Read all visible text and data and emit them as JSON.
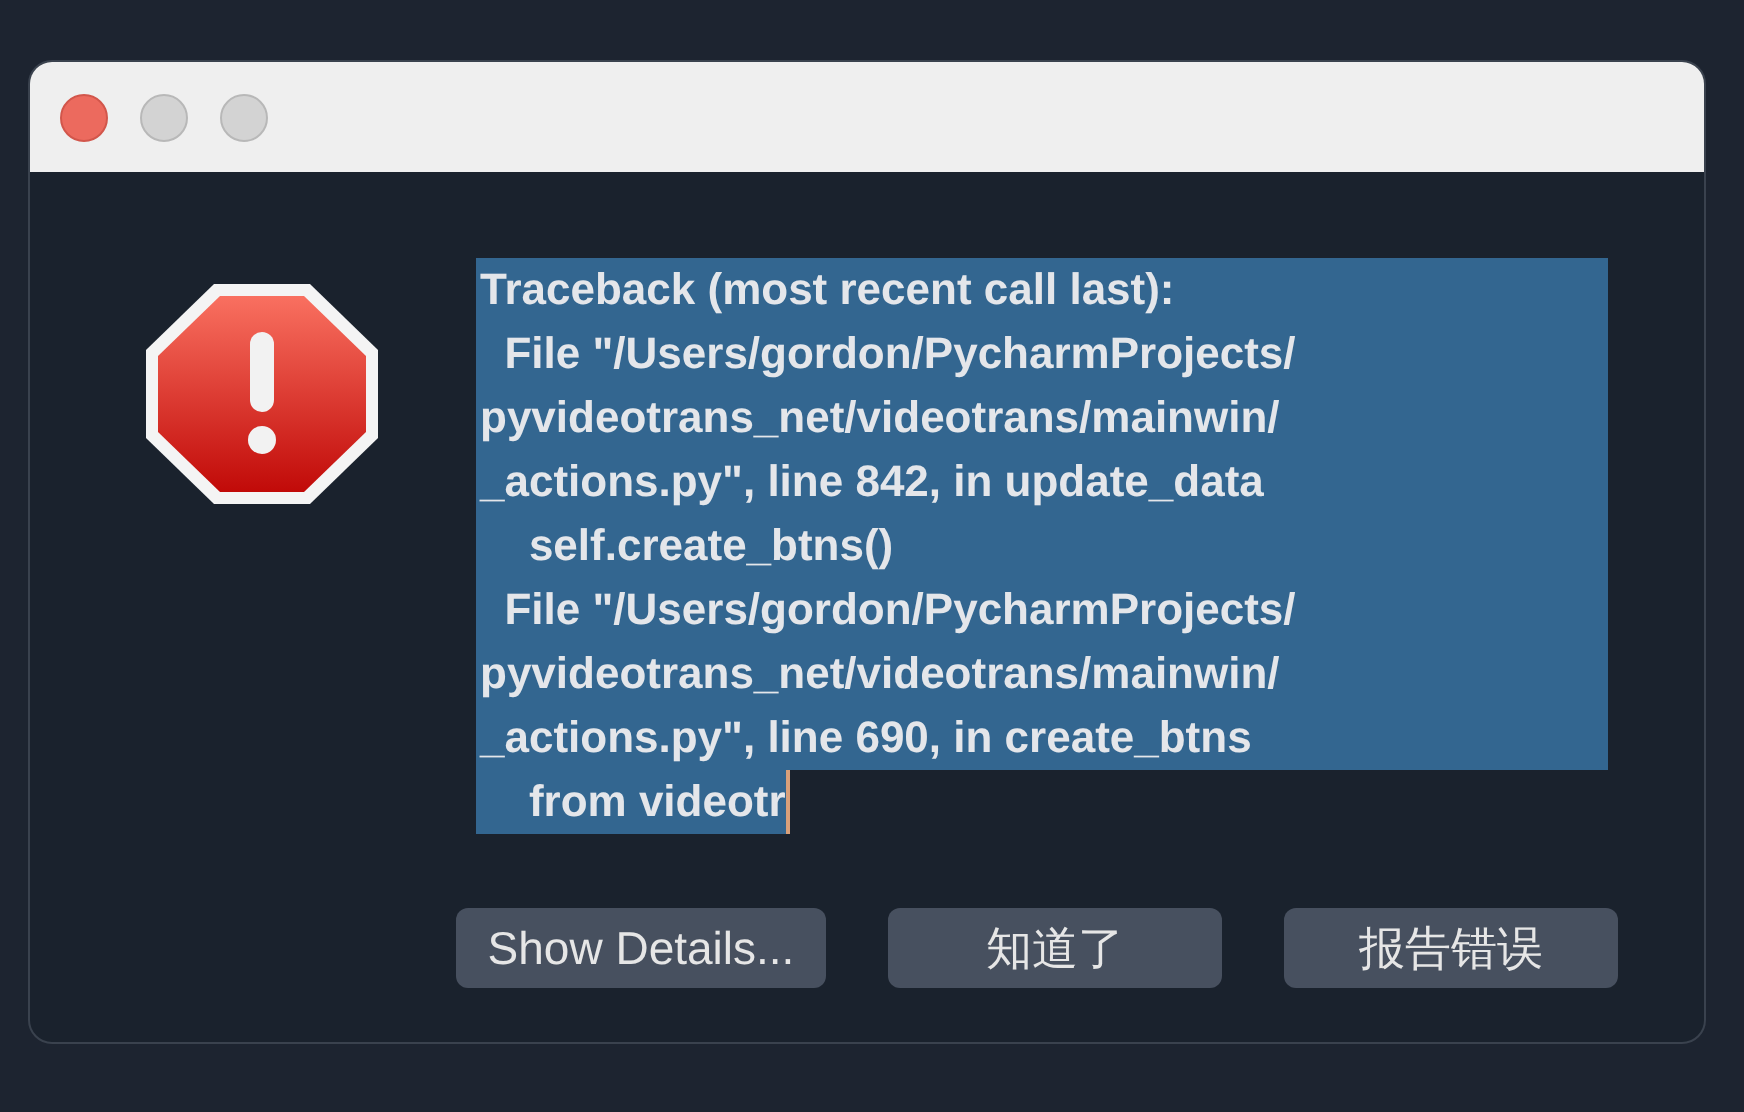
{
  "window": {
    "controls": [
      {
        "kind": "close",
        "disabled": false
      },
      {
        "kind": "minimize",
        "disabled": true
      },
      {
        "kind": "zoom",
        "disabled": true
      }
    ]
  },
  "message": {
    "selected": true,
    "lines": [
      "Traceback (most recent call last):",
      "  File \"/Users/gordon/PycharmProjects/",
      "pyvideotrans_net/videotrans/mainwin/",
      "_actions.py\", line 842, in update_data",
      "    self.create_btns()",
      "  File \"/Users/gordon/PycharmProjects/",
      "pyvideotrans_net/videotrans/mainwin/",
      "_actions.py\", line 690, in create_btns",
      "    from videotr"
    ]
  },
  "buttons": [
    "Show Details...",
    "知道了",
    "报告错误"
  ]
}
